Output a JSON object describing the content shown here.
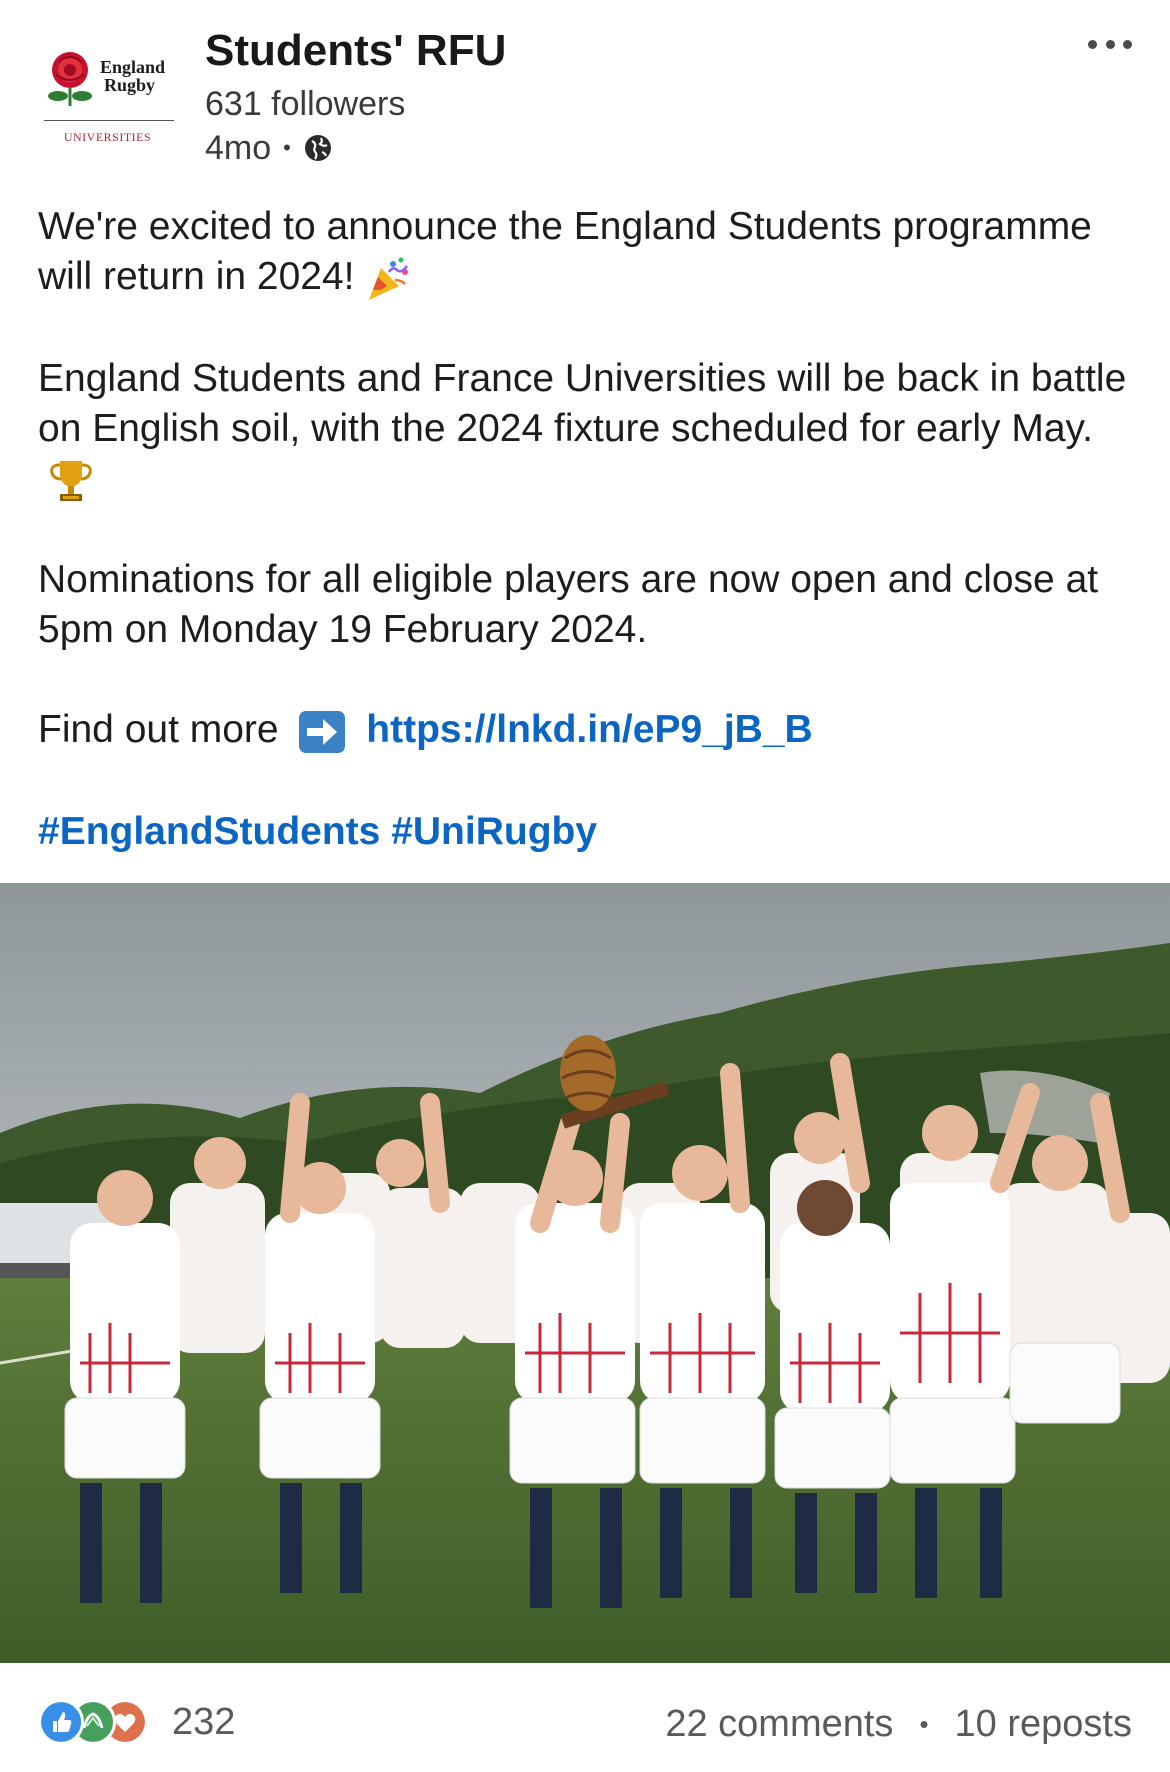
{
  "post": {
    "author": {
      "name": "Students' RFU",
      "followers": "631 followers",
      "age": "4mo",
      "visibility_icon": "globe-icon",
      "logo": {
        "wordmark_line1": "England",
        "wordmark_line2": "Rugby",
        "subtitle": "UNIVERSITIES",
        "emblem": "red-rose"
      }
    },
    "menu_icon": "more-icon",
    "body": {
      "p1": "We're excited to announce the England Students programme will return in 2024!",
      "p1_emoji": "party-popper-icon",
      "p2": "England Students and France Universities will be back in battle on English soil, with the 2024 fixture scheduled for early May.",
      "p2_emoji": "trophy-icon",
      "p3": "Nominations for all eligible players are now open and close at 5pm on Monday 19 February 2024.",
      "p4_prefix": "Find out more",
      "p4_emoji": "right-arrow-icon",
      "link": "https://lnkd.in/eP9_jB_B",
      "hashtags": [
        "#EnglandStudents",
        "#UniRugby"
      ]
    },
    "image": {
      "subject": "England Students rugby team celebrating with a trophy on a pitch"
    },
    "footer": {
      "reactions": [
        "like-icon",
        "celebrate-icon",
        "love-icon"
      ],
      "reaction_count": "232",
      "comments": "22 comments",
      "reposts": "10 reposts"
    }
  },
  "colors": {
    "link": "#0a66c2",
    "text": "#1d1d1d",
    "muted": "#5a5a5a",
    "brand_red": "#b3273b"
  }
}
